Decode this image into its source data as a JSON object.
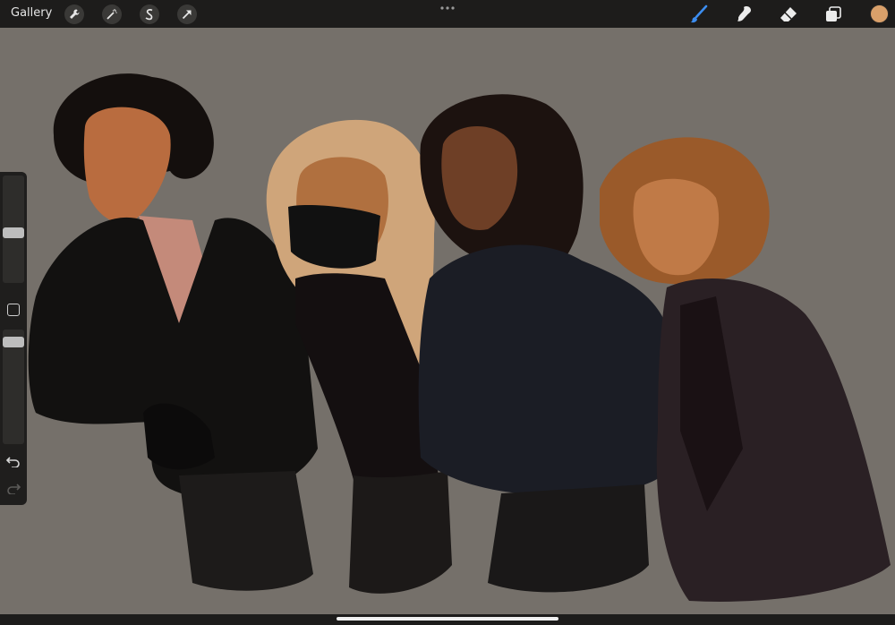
{
  "toolbar": {
    "gallery_label": "Gallery",
    "left_tools": [
      "wrench-icon",
      "magic-wand-icon",
      "selection-icon",
      "transform-arrow-icon"
    ],
    "right_tools": [
      "brush-icon",
      "smudge-icon",
      "eraser-icon",
      "layers-icon"
    ],
    "active_tool_color": "#3c8df0",
    "current_color": "#d9a06a"
  },
  "sidebar": {
    "brush_size_level": 0.55,
    "opacity_level": 0.9,
    "icons": [
      "modify-square-icon",
      "undo-icon",
      "redo-icon"
    ]
  },
  "canvas": {
    "background_color": "#75706a",
    "artwork": "four-figures-illustration"
  }
}
